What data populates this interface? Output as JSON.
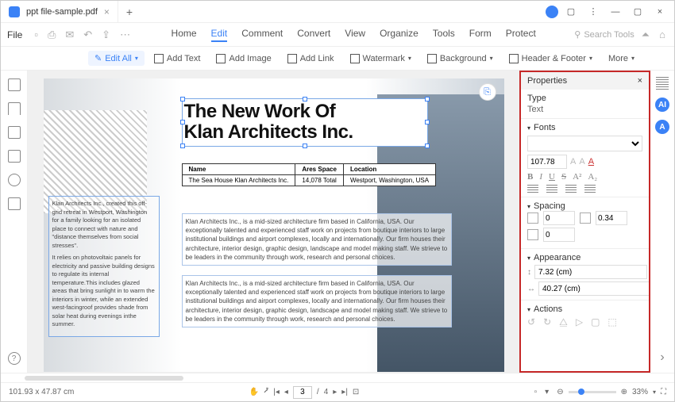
{
  "titlebar": {
    "tab_title": "ppt file-sample.pdf"
  },
  "menubar": {
    "file": "File",
    "tabs": [
      "Home",
      "Edit",
      "Comment",
      "Convert",
      "View",
      "Organize",
      "Tools",
      "Form",
      "Protect"
    ],
    "active_index": 1,
    "search_placeholder": "Search Tools"
  },
  "toolbar": {
    "edit_all": "Edit All",
    "add_text": "Add Text",
    "add_image": "Add Image",
    "add_link": "Add Link",
    "watermark": "Watermark",
    "background": "Background",
    "header_footer": "Header & Footer",
    "more": "More"
  },
  "document": {
    "title_line1": "The New Work Of",
    "title_line2": "Klan Architects Inc.",
    "info_headers": [
      "Name",
      "Ares Space",
      "Location"
    ],
    "info_row": [
      "The Sea House Klan Architects Inc.",
      "14,078 Total",
      "Westport, Washington, USA"
    ],
    "side_p1": "Klan Architects Inc., created this off-grid retreat in Westport, Washington for a family looking for an isolated place to connect with nature and \"distance themselves from social stresses\".",
    "side_p2": "It relies on photovoltaic panels for electricity and passive building designs to regulate its internal temperature.This includes glazed areas that bring sunlight in to warm the interiors in winter, while an extended west-facingroof provides shade from solar heat during evenings inthe summer.",
    "body_p": "Klan Architects Inc., is a mid-sized architecture firm based in California, USA. Our exceptionally talented and experienced staff work on projects from boutique interiors to large institutional buildings and airport complexes, locally and internationally. Our firm houses their architecture, interior design, graphic design, landscape and model making staff. We strieve to be leaders in the community through work, research and personal choices."
  },
  "properties": {
    "title": "Properties",
    "type_label": "Type",
    "type_value": "Text",
    "fonts_label": "Fonts",
    "font_size": "107.78",
    "spacing_label": "Spacing",
    "spacing_v1": "0",
    "spacing_v2": "0.34",
    "spacing_v3": "0",
    "appearance_label": "Appearance",
    "width": "7.32 (cm)",
    "height": "40.27 (cm)",
    "actions_label": "Actions"
  },
  "status": {
    "coords": "101.93 x 47.87 cm",
    "page_current": "3",
    "page_total": "4",
    "zoom": "33%"
  }
}
